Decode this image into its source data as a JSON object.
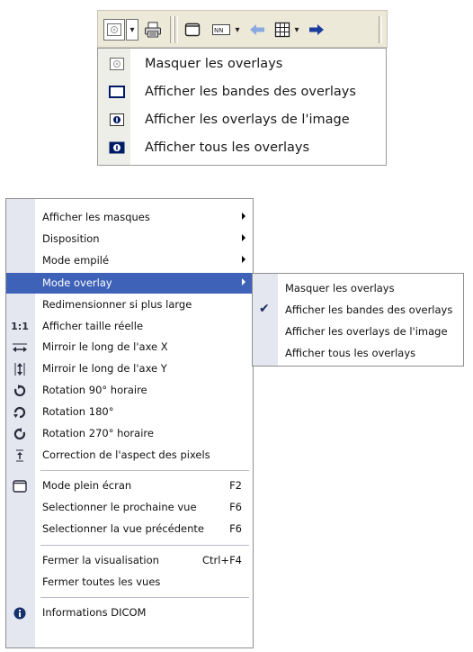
{
  "toolbar": {
    "icons": [
      "overlay-button-icon",
      "dropdown-arrow",
      "print-icon",
      "window-icon",
      "layout-icon",
      "dropdown-arrow",
      "left-arrow-icon",
      "grid-icon",
      "dropdown-arrow",
      "right-arrow-icon"
    ],
    "colors": {
      "arrow_left": "#8aa9e0",
      "arrow_right": "#1a3d9e"
    }
  },
  "overlay_menu": {
    "items": [
      {
        "label": "Masquer les overlays",
        "icon": "hide-overlays-icon"
      },
      {
        "label": "Afficher les bandes des overlays",
        "icon": "overlay-bands-icon"
      },
      {
        "label": "Afficher les overlays de l'image",
        "icon": "image-overlays-icon"
      },
      {
        "label": "Afficher tous les overlays",
        "icon": "all-overlays-icon"
      }
    ]
  },
  "context_menu": {
    "items": [
      {
        "label": "Afficher les masques",
        "submenu": true
      },
      {
        "label": "Disposition",
        "submenu": true
      },
      {
        "label": "Mode empilé",
        "submenu": true
      },
      {
        "label": "Mode overlay",
        "submenu": true,
        "highlighted": true
      },
      {
        "label": "Redimensionner si plus large"
      },
      {
        "label": "Afficher taille réelle",
        "icon_text": "1:1"
      },
      {
        "label": "Mirroir le long de l'axe X",
        "icon": "mirror-horizontal-icon"
      },
      {
        "label": "Mirroir le long de l'axe Y",
        "icon": "mirror-vertical-icon"
      },
      {
        "label": "Rotation 90° horaire",
        "icon": "rotate-90-icon"
      },
      {
        "label": "Rotation 180°",
        "icon": "rotate-180-icon"
      },
      {
        "label": "Rotation 270° horaire",
        "icon": "rotate-270-icon"
      },
      {
        "label": "Correction de l'aspect des pixels",
        "icon": "pixel-aspect-icon"
      },
      {
        "label": "Mode plein écran",
        "shortcut": "F2",
        "icon": "fullscreen-icon"
      },
      {
        "label": "Selectionner le prochaine vue",
        "shortcut": "F6"
      },
      {
        "label": "Selectionner la vue précédente",
        "shortcut": "F6"
      },
      {
        "label": "Fermer la visualisation",
        "shortcut": "Ctrl+F4"
      },
      {
        "label": "Fermer toutes les vues"
      },
      {
        "label": "Informations DICOM",
        "icon": "info-icon"
      }
    ],
    "highlight_color": "#3e62b8"
  },
  "overlay_submenu": {
    "items": [
      {
        "label": "Masquer les overlays",
        "checked": false
      },
      {
        "label": "Afficher les bandes des overlays",
        "checked": true
      },
      {
        "label": "Afficher les overlays de l'image",
        "checked": false
      },
      {
        "label": "Afficher tous les overlays",
        "checked": false
      }
    ]
  }
}
